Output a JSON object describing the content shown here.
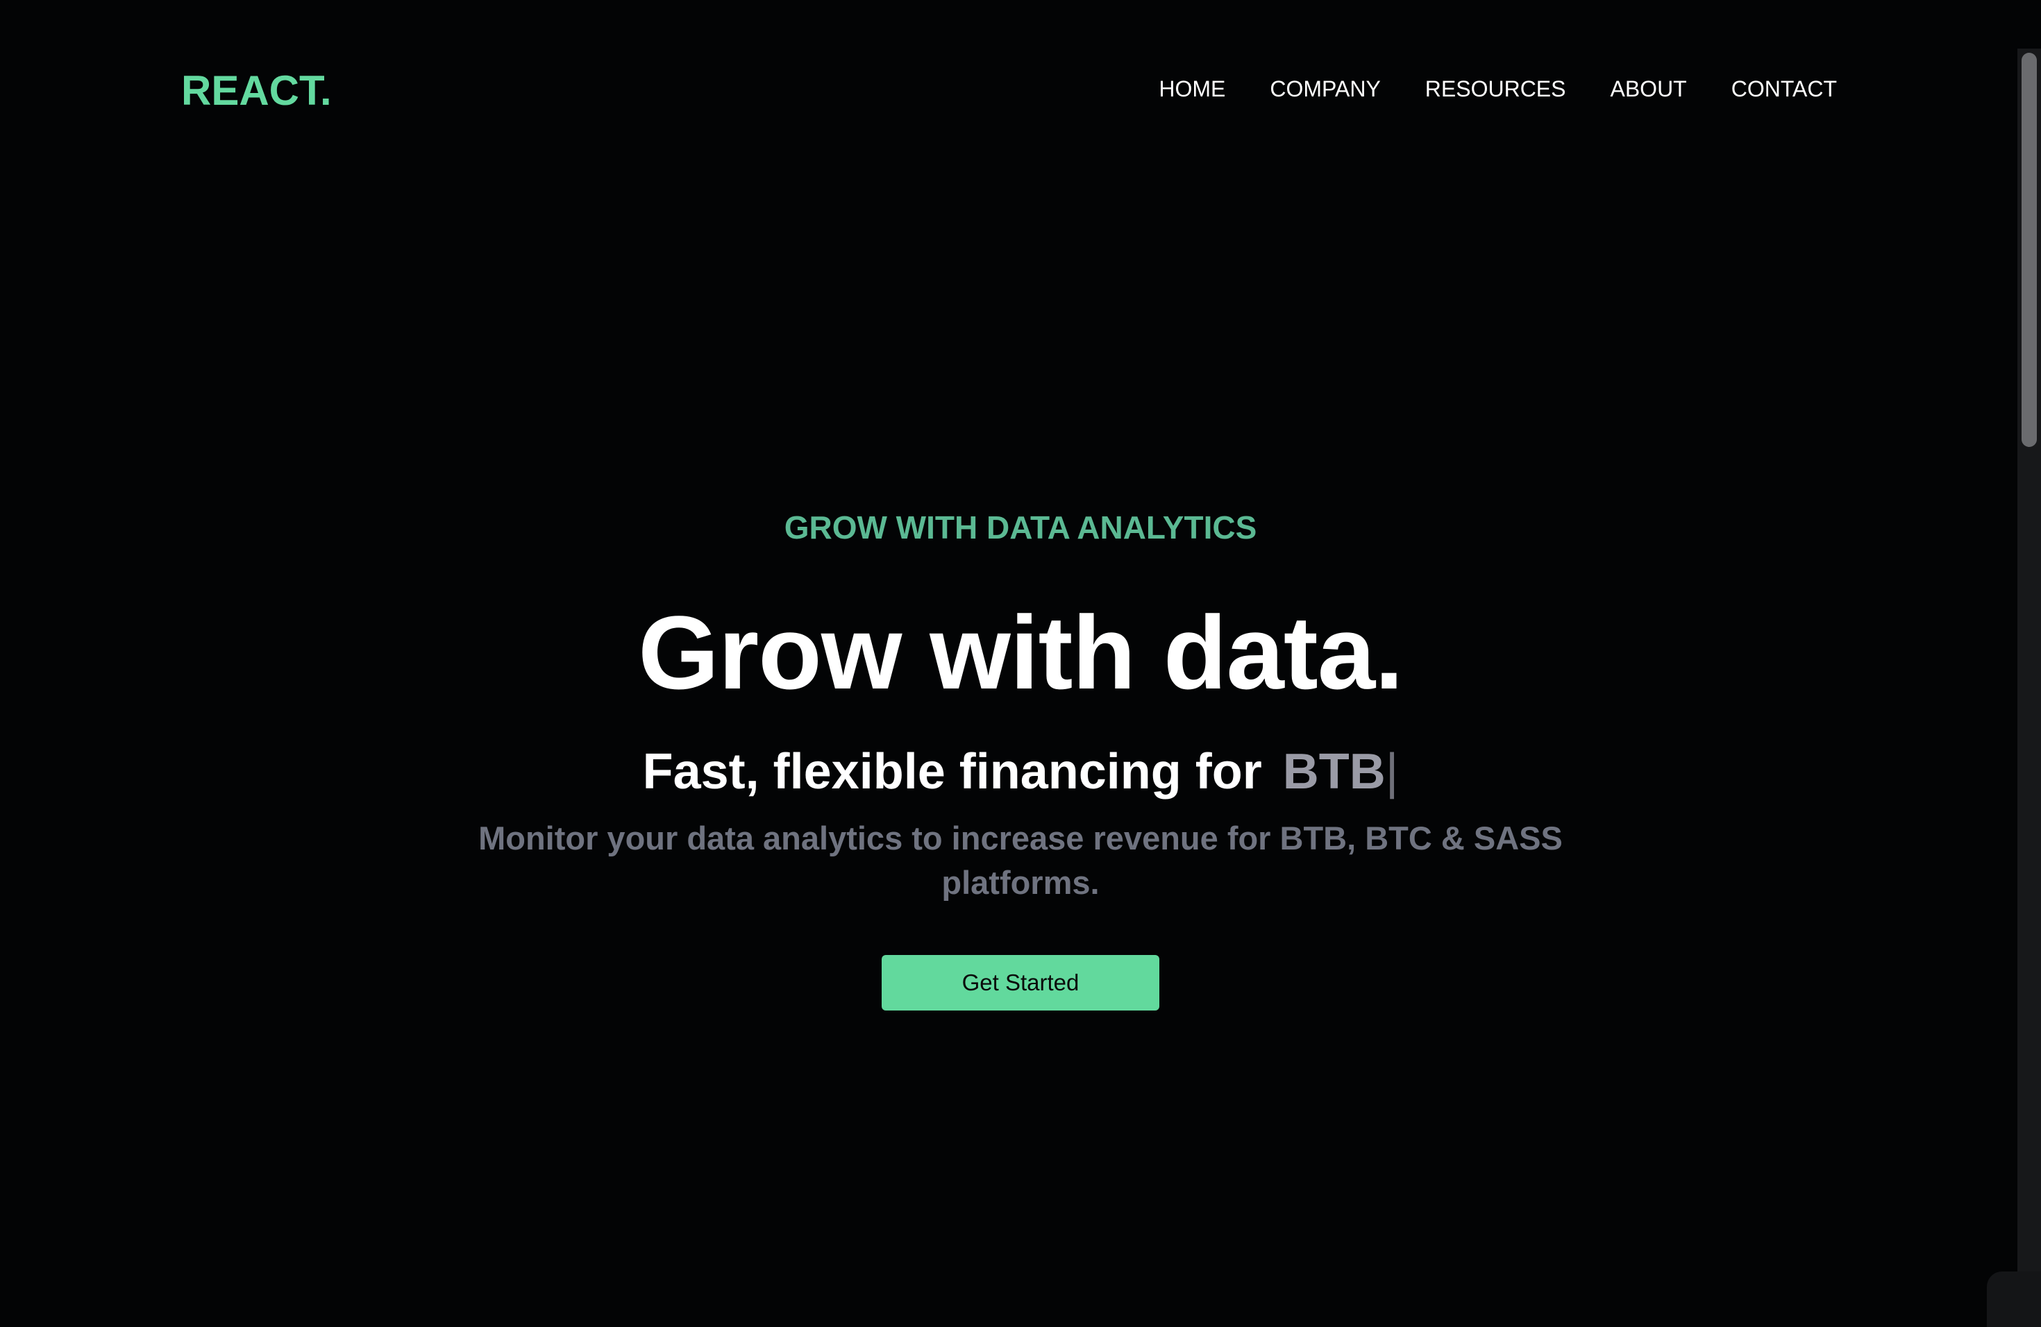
{
  "header": {
    "logo": "REACT.",
    "nav": [
      {
        "label": "HOME"
      },
      {
        "label": "COMPANY"
      },
      {
        "label": "RESOURCES"
      },
      {
        "label": "ABOUT"
      },
      {
        "label": "CONTACT"
      }
    ]
  },
  "hero": {
    "eyebrow": "GROW WITH DATA ANALYTICS",
    "headline": "Grow with data.",
    "subline_prefix": "Fast, flexible financing for",
    "typed_word": "BTB",
    "caret": "|",
    "description": "Monitor your data analytics to increase revenue for BTB, BTC & SASS platforms.",
    "cta_label": "Get Started"
  },
  "colors": {
    "background": "#030405",
    "accent": "#63d99f",
    "eyebrow": "#5bb993",
    "muted_text": "#6f7380",
    "typed_text": "#9a9ba6"
  }
}
